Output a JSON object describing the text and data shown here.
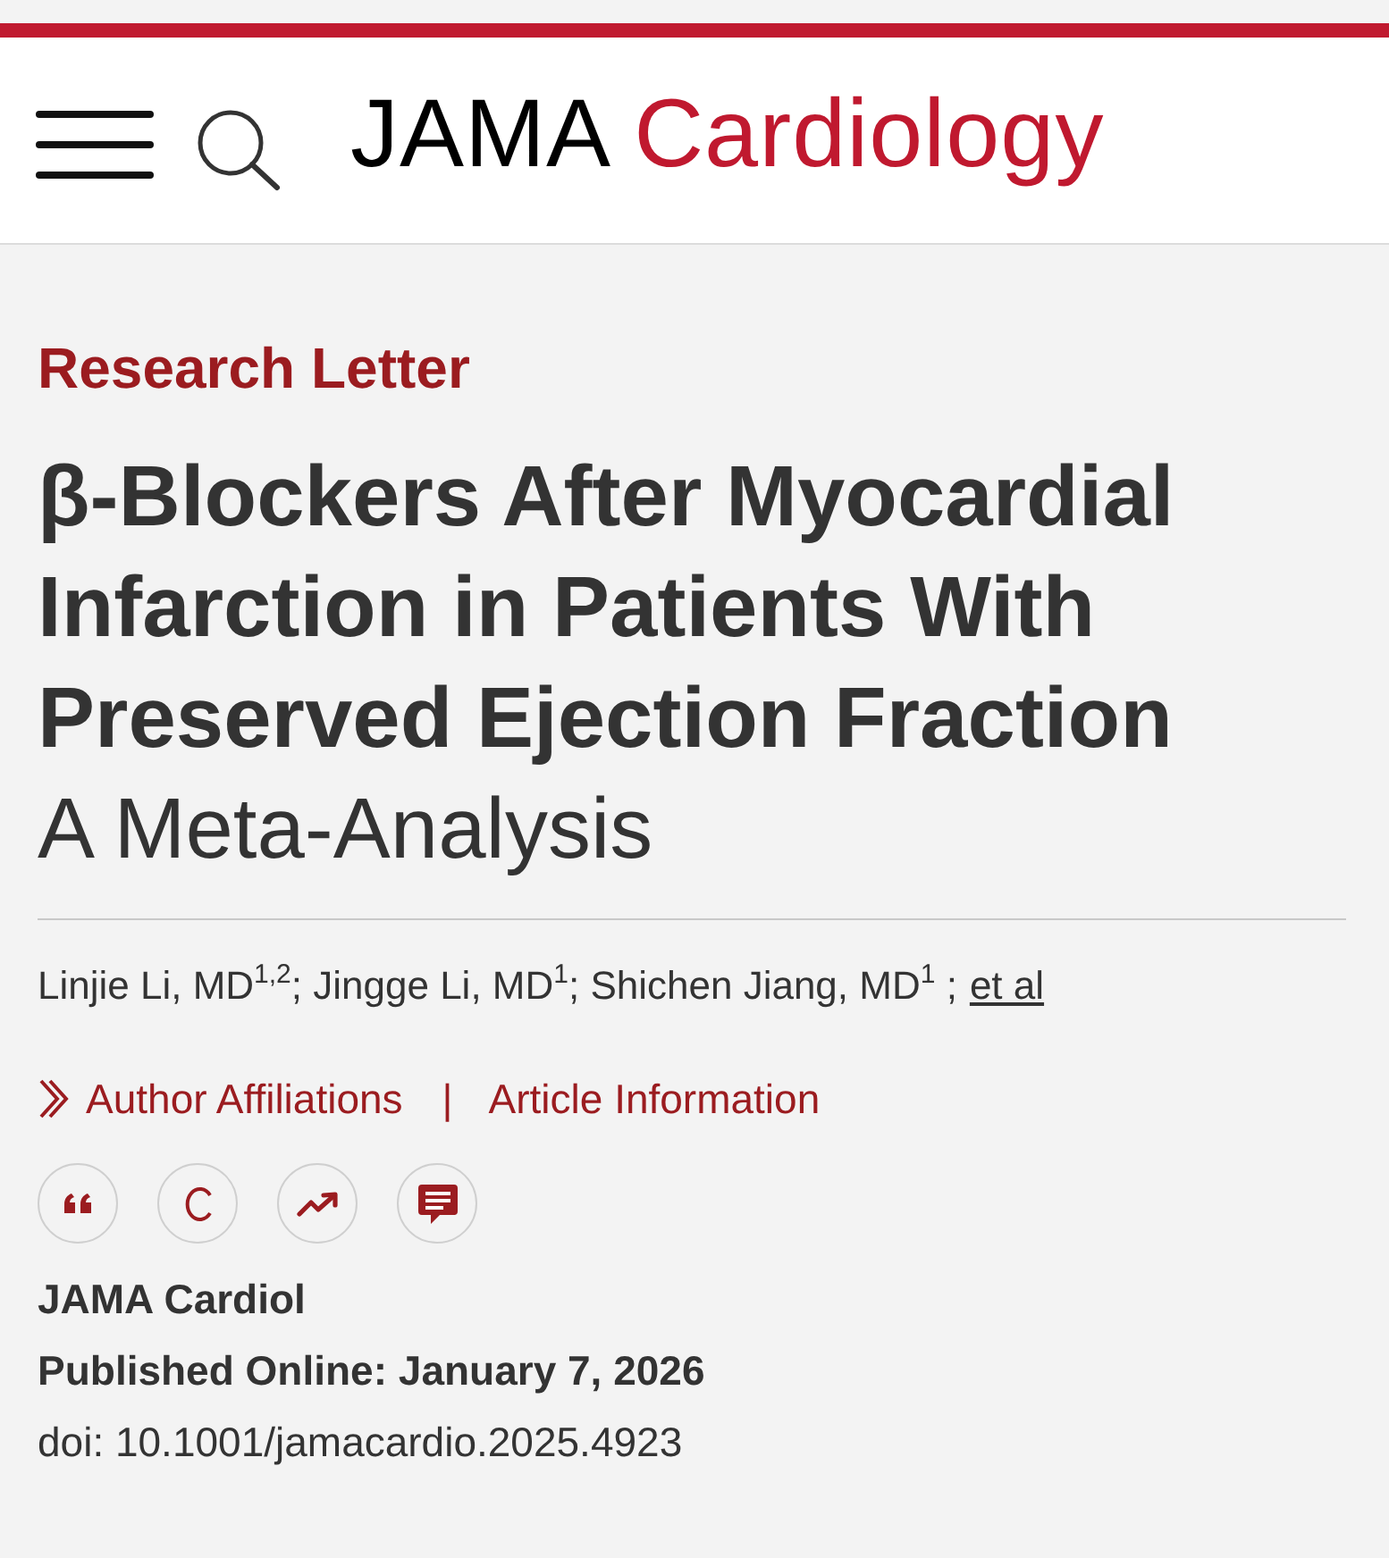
{
  "header": {
    "logo": {
      "brand": "JAMA",
      "journal": "Cardiology"
    }
  },
  "article": {
    "type": "Research Letter",
    "title": "β-Blockers After Myocardial Infarction in Patients With Preserved Ejection Fraction",
    "subtitle": "A Meta-Analysis",
    "authors": "Linjie Li, MD$^{1,2}$; Jingge Li, MD$^{1}$; Shichen Jiang, MD$^{1}$ ;",
    "authors_link": "et al",
    "info_links": [
      {
        "label": "Author Affiliations",
        "kind": "expand"
      },
      {
        "label": "Article Information",
        "kind": "plain"
      }
    ],
    "separator": "|",
    "actions": [
      {
        "kind": "cite"
      },
      {
        "kind": "permissions"
      },
      {
        "kind": "metrics"
      },
      {
        "kind": "comments"
      }
    ],
    "journal": "JAMA Cardiol",
    "published": "Published Online: January 7, 2026",
    "doi": "doi: 10.1001/jamacardio.2025.4923"
  }
}
